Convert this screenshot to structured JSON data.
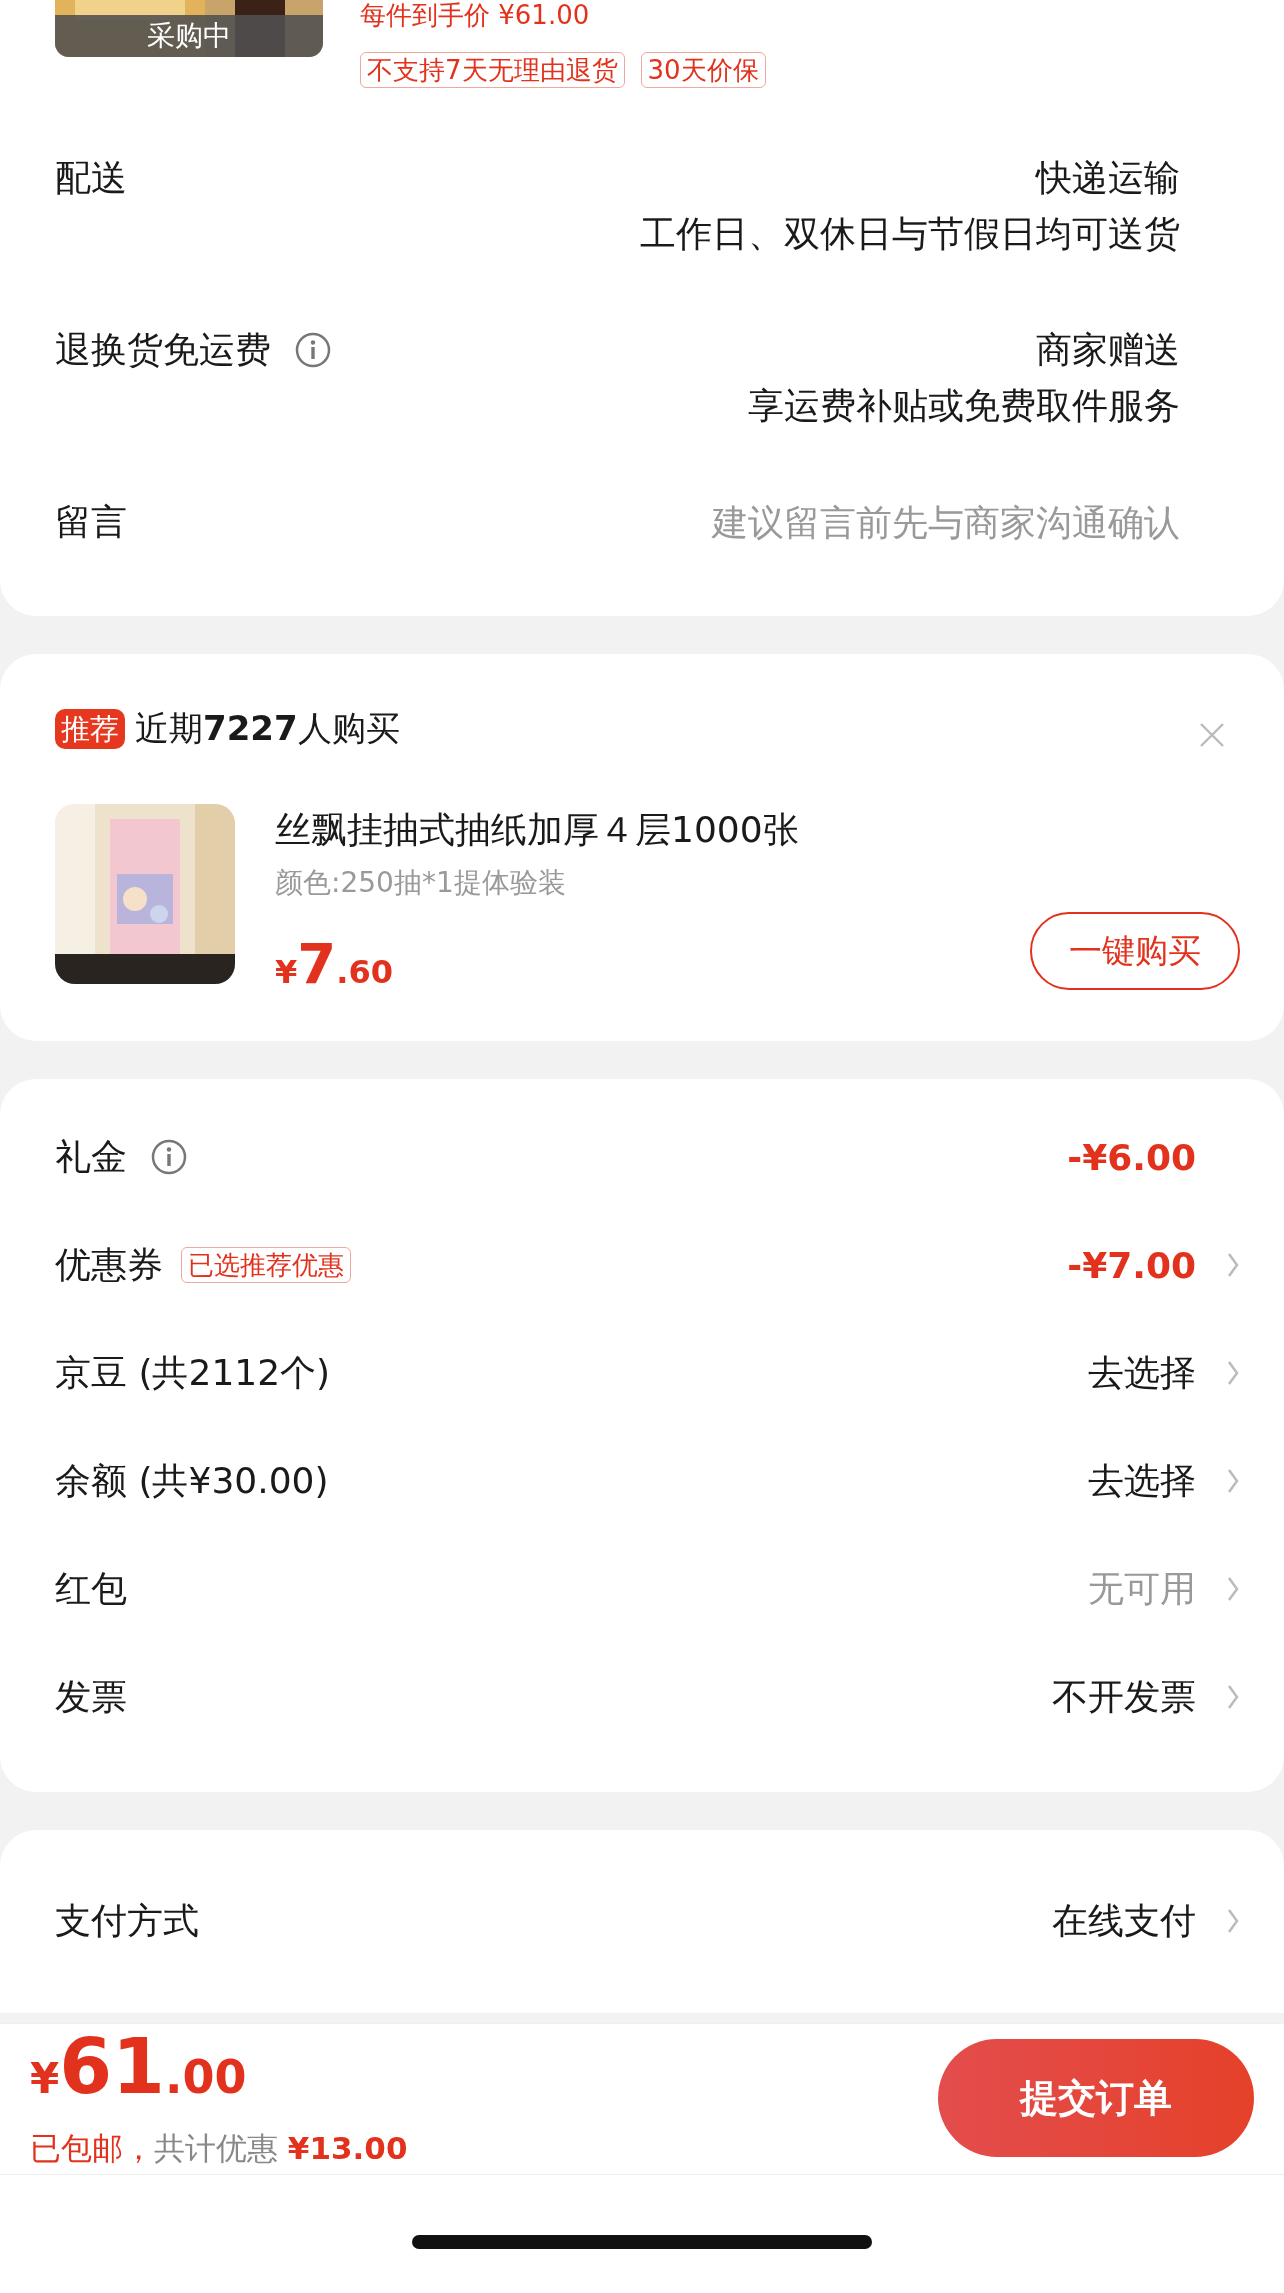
{
  "product": {
    "status": "采购中",
    "price_line": "每件到手价 ¥61.00",
    "tags": [
      "不支持7天无理由退货",
      "30天价保"
    ]
  },
  "order_rows": [
    {
      "kind": "text",
      "label": "配送",
      "info": false,
      "values": [
        "快递运输",
        "工作日、双休日与节假日均可送货"
      ]
    },
    {
      "kind": "text",
      "label": "退换货免运费",
      "info": true,
      "values": [
        "商家赠送",
        "享运费补贴或免费取件服务"
      ]
    },
    {
      "kind": "note",
      "label": "留言",
      "info": false,
      "placeholder": "建议留言前先与商家沟通确认"
    }
  ],
  "recommendation": {
    "badge": "推荐",
    "headline": "近期**7227**人购买",
    "title": "丝飘挂抽式抽纸加厚４层1000张",
    "spec": "颜色:250抽*1提体验装",
    "price": {
      "currency": "¥",
      "integer": "7",
      "decimal": ".60"
    },
    "button": "一键购买"
  },
  "cost_rows": [
    {
      "label": "礼金",
      "info": true,
      "value": "-¥6.00",
      "kind": "discount",
      "chevron": false
    },
    {
      "label": "优惠券",
      "info": false,
      "tag": "已选推荐优惠",
      "value": "-¥7.00",
      "kind": "discount",
      "chevron": true
    },
    {
      "label": "京豆 (共2112个)",
      "info": false,
      "value": "去选择",
      "kind": "normal",
      "chevron": true
    },
    {
      "label": "余额 (共¥30.00)",
      "info": false,
      "value": "去选择",
      "kind": "normal",
      "chevron": true
    },
    {
      "label": "红包",
      "info": false,
      "value": "无可用",
      "kind": "muted",
      "chevron": true
    },
    {
      "label": "发票",
      "info": false,
      "value": "不开发票",
      "kind": "normal",
      "chevron": true
    }
  ],
  "payment": {
    "label": "支付方式",
    "value": "在线支付",
    "chevron": true
  },
  "footer": {
    "total": {
      "currency": "¥",
      "integer": "61",
      "decimal": ".00"
    },
    "note": [
      {
        "text": "已包邮，",
        "kind": "accent"
      },
      {
        "text": "共计优惠 ",
        "kind": "muted"
      },
      {
        "text": "¥13.00",
        "kind": "strong"
      }
    ],
    "submit": "提交订单"
  }
}
